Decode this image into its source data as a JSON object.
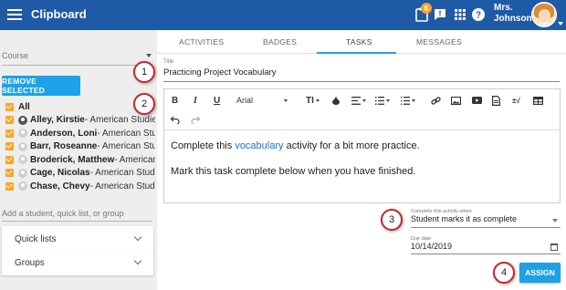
{
  "app": {
    "title": "Clipboard",
    "notif_count": "6",
    "user_line1": "Mrs.",
    "user_line2": "Johnson"
  },
  "sidebar": {
    "course_placeholder": "Course",
    "remove_label": "REMOVE SELECTED",
    "students": [
      {
        "name": "All",
        "class": ""
      },
      {
        "name": "Alley, Kirstie",
        "class": " - American Studies"
      },
      {
        "name": "Anderson, Loni",
        "class": " - American Studies"
      },
      {
        "name": "Barr, Roseanne",
        "class": " - American Studies"
      },
      {
        "name": "Broderick, Matthew",
        "class": " - American Studies"
      },
      {
        "name": "Cage, Nicolas",
        "class": " - American Studies"
      },
      {
        "name": "Chase, Chevy",
        "class": " - American Studies"
      }
    ],
    "add_placeholder": "Add a student, quick list, or group",
    "quick_lists": "Quick lists",
    "groups": "Groups"
  },
  "tabs": [
    "ACTIVITIES",
    "BADGES",
    "TASKS",
    "MESSAGES"
  ],
  "task": {
    "title_label": "Title",
    "title_value": "Practicing Project Vocabulary",
    "toolbar": {
      "bold": "B",
      "italic": "I",
      "underline": "U",
      "font": "Arial",
      "size": "TI"
    },
    "content_before_link": "Complete this ",
    "content_link": "vocabulary",
    "content_after_link": " activity for a bit more practice.",
    "content_line2": "Mark this task complete below when you have finished.",
    "complete_label": "Complete this activity when",
    "complete_value": "Student marks it as complete",
    "due_label": "Due date",
    "due_value": "10/14/2019",
    "assign_label": "ASSIGN"
  },
  "callouts": [
    "1",
    "2",
    "3",
    "4"
  ],
  "colors": {
    "header": "#1f5aa6",
    "accent": "#1ea1e6",
    "checkbox": "#f5a623",
    "callout_border": "#c1272d"
  }
}
